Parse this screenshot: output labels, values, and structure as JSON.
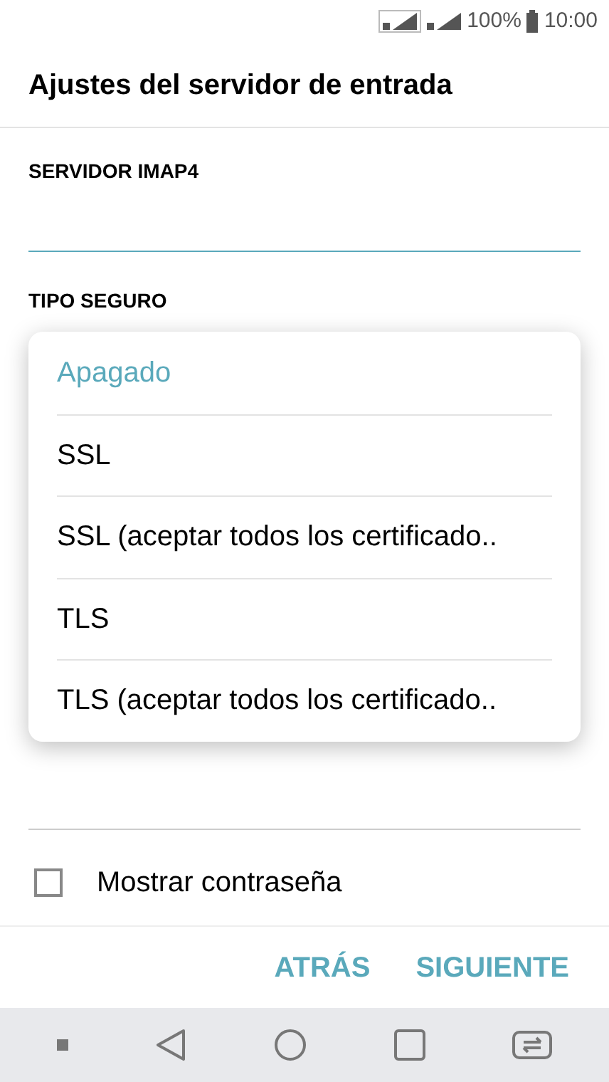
{
  "status_bar": {
    "battery": "100%",
    "time": "10:00"
  },
  "title": "Ajustes del servidor de entrada",
  "server_field": {
    "label": "SERVIDOR IMAP4",
    "focused": true
  },
  "security_label": "TIPO SEGURO",
  "dropdown": [
    {
      "label": "Apagado",
      "selected": true
    },
    {
      "label": "SSL",
      "selected": false
    },
    {
      "label": "SSL (aceptar todos los certificado..",
      "selected": false
    },
    {
      "label": "TLS",
      "selected": false
    },
    {
      "label": "TLS (aceptar todos los certificado..",
      "selected": false
    }
  ],
  "password_field": {
    "focused": false
  },
  "show_password": {
    "label": "Mostrar contraseña",
    "checked": false
  },
  "buttons": [
    "ATRÁS",
    "SIGUIENTE"
  ]
}
